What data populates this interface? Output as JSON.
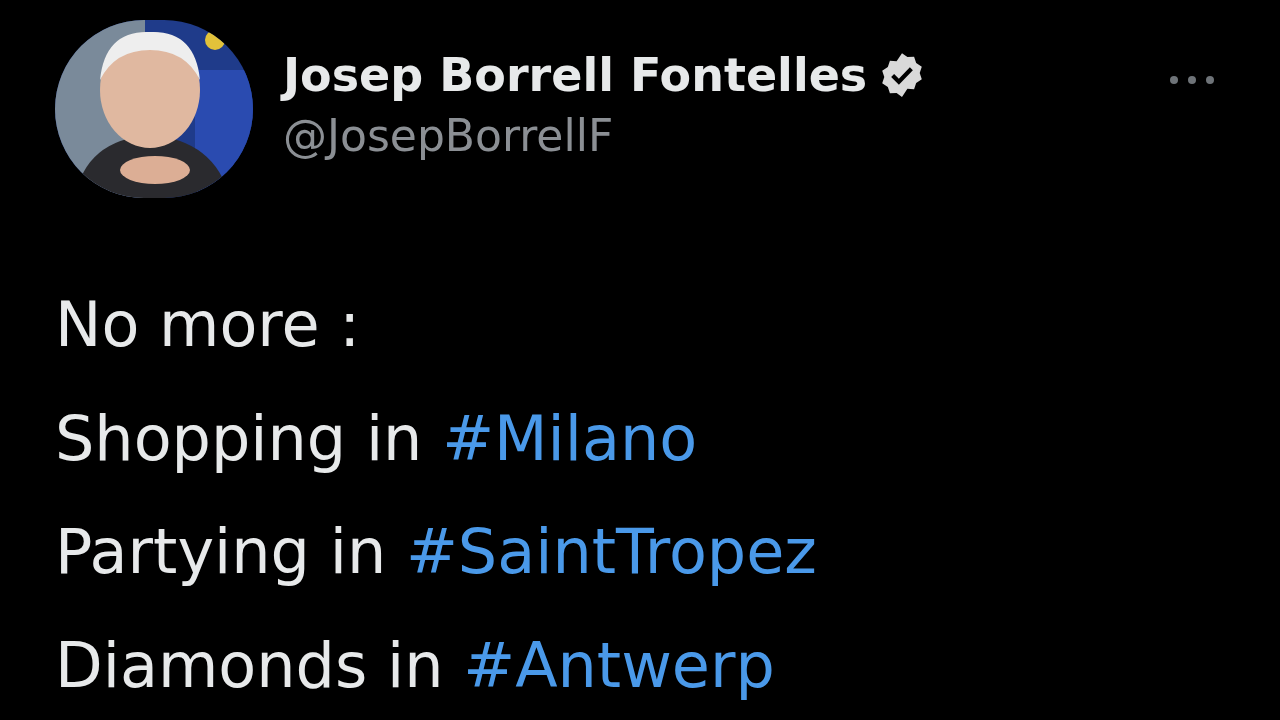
{
  "author": {
    "name": "Josep Borrell Fontelles",
    "verified": true,
    "handle": "@JosepBorrellF"
  },
  "lines": [
    {
      "text": "No more :"
    },
    {
      "text": "Shopping in",
      "hashtag": "#Milano"
    },
    {
      "text": "Partying in",
      "hashtag": "#SaintTropez"
    },
    {
      "text": "Diamonds in",
      "hashtag": "#Antwerp"
    }
  ]
}
